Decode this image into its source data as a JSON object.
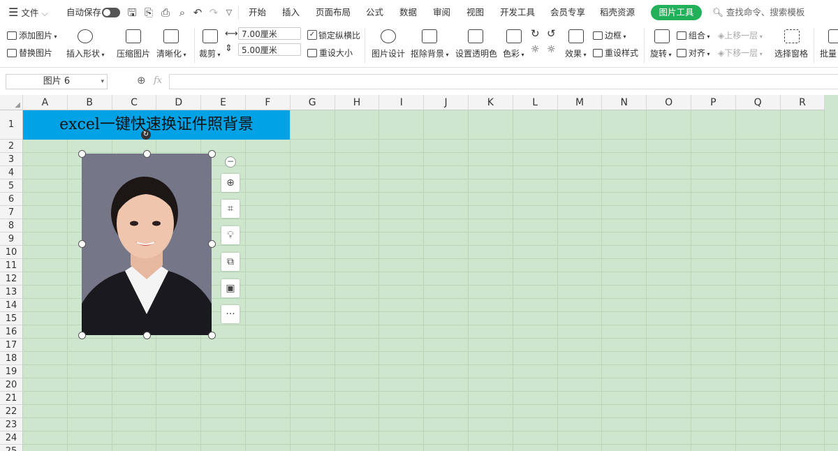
{
  "menubar": {
    "file": "文件",
    "autosave": "自动保存",
    "tabs": [
      "开始",
      "插入",
      "页面布局",
      "公式",
      "数据",
      "审阅",
      "视图",
      "开发工具",
      "会员专享",
      "稻壳资源"
    ],
    "active_tab": "图片工具",
    "search_placeholder": "查找命令、搜索模板",
    "accent": "#22b05a"
  },
  "ribbon": {
    "add_picture": "添加图片",
    "replace_picture": "替换图片",
    "insert_shape": "插入形状",
    "compress_picture": "压缩图片",
    "sharpen": "清晰化",
    "crop": "裁剪",
    "width": "7.00厘米",
    "height": "5.00厘米",
    "lock_ratio": "锁定纵横比",
    "reset_size": "重设大小",
    "picture_design": "图片设计",
    "remove_background": "抠除背景",
    "set_transparent": "设置透明色",
    "color": "色彩",
    "effects": "效果",
    "border": "边框",
    "reset_style": "重设样式",
    "rotate": "旋转",
    "group": "组合",
    "align": "对齐",
    "bring_forward": "上移一层",
    "send_backward": "下移一层",
    "selection_pane": "选择窗格",
    "batch": "批量"
  },
  "formula_bar": {
    "name_box": "图片 6",
    "fx": "fx",
    "value": ""
  },
  "sheet": {
    "columns": [
      "A",
      "B",
      "C",
      "D",
      "E",
      "F",
      "G",
      "H",
      "I",
      "J",
      "K",
      "L",
      "M",
      "N",
      "O",
      "P",
      "Q",
      "R"
    ],
    "rows": [
      "1",
      "2",
      "3",
      "4",
      "5",
      "6",
      "7",
      "8",
      "9",
      "10",
      "11",
      "12",
      "13",
      "14",
      "15",
      "16",
      "17",
      "18",
      "19",
      "20",
      "21",
      "22",
      "23",
      "24",
      "25"
    ],
    "title_cell": "excel一键快速换证件照背景",
    "title_bg": "#02a2e6",
    "grid_bg": "#cde6cd",
    "photo_bg": "#757688"
  }
}
